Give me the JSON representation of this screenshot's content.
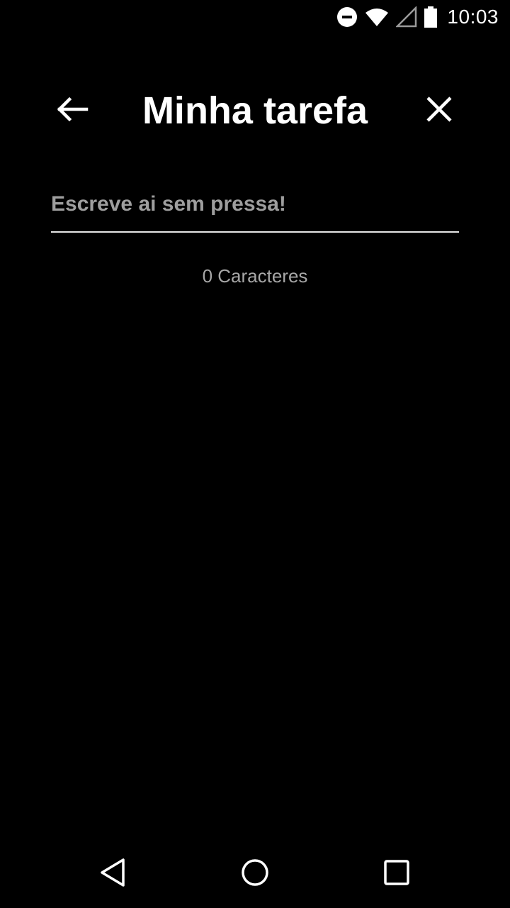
{
  "status_bar": {
    "time": "10:03",
    "icons": [
      "do-not-disturb-icon",
      "wifi-icon",
      "cell-signal-icon",
      "battery-icon"
    ]
  },
  "header": {
    "title": "Minha tarefa",
    "back_icon": "arrow-left-icon",
    "close_icon": "close-icon"
  },
  "task_input": {
    "value": "",
    "placeholder": "Escreve ai sem pressa!"
  },
  "char_counter": {
    "text": "0 Caracteres"
  },
  "nav_bar": {
    "icons": [
      "nav-back-icon",
      "nav-home-icon",
      "nav-recents-icon"
    ]
  },
  "colors": {
    "background": "#000000",
    "text": "#ffffff",
    "placeholder": "#9e9e9e",
    "counter": "#a6a6a6",
    "underline": "#e6e6e6"
  }
}
